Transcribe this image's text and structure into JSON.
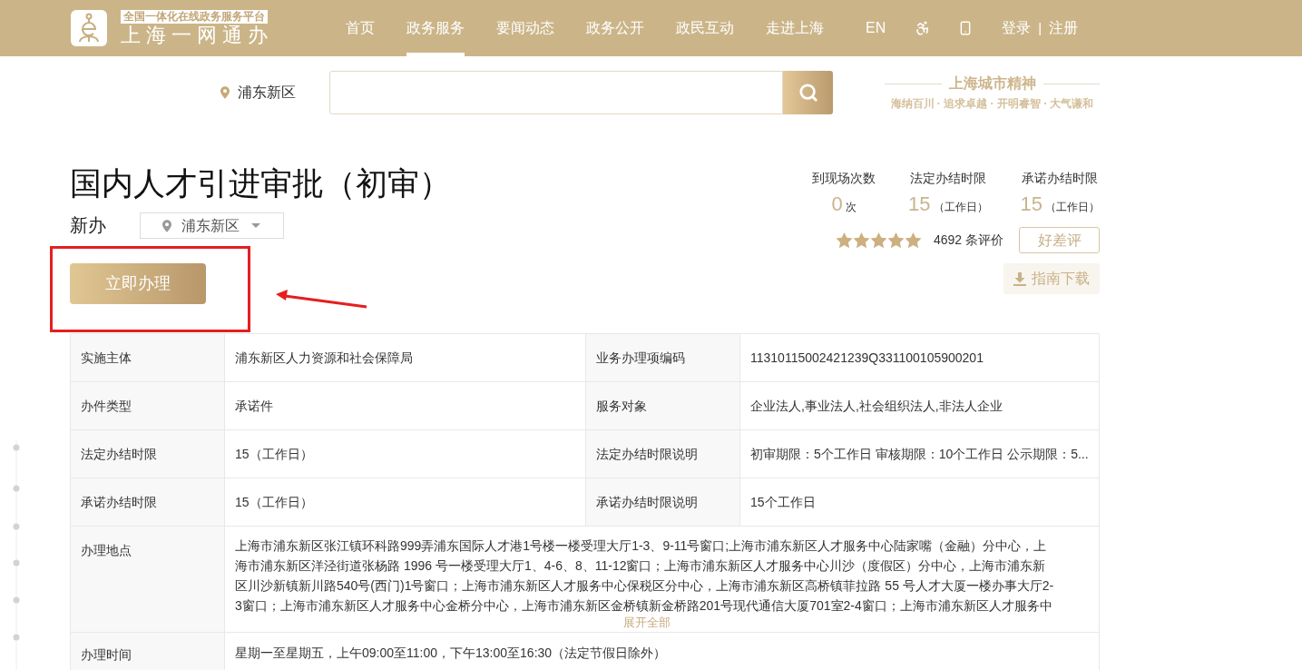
{
  "header": {
    "tagline": "全国一体化在线政务服务平台",
    "site_name": "上海一网通办",
    "nav": [
      {
        "label": "首页",
        "selected": false
      },
      {
        "label": "政务服务",
        "selected": true
      },
      {
        "label": "要闻动态",
        "selected": false
      },
      {
        "label": "政务公开",
        "selected": false
      },
      {
        "label": "政民互动",
        "selected": false
      },
      {
        "label": "走进上海",
        "selected": false
      }
    ],
    "language": "EN",
    "login": "登录",
    "separator": "|",
    "register": "注册"
  },
  "search": {
    "region": "浦东新区"
  },
  "slogan": {
    "title": "上海城市精神",
    "motto": "海纳百川 · 追求卓越 · 开明睿智 · 大气谦和"
  },
  "service": {
    "title": "国内人才引进审批（初审）",
    "type": "新办",
    "region": "浦东新区",
    "action": "立即办理"
  },
  "stats": [
    {
      "label": "到现场次数",
      "value": "0",
      "unit": "次"
    },
    {
      "label": "法定办结时限",
      "value": "15",
      "unit": "（工作日）"
    },
    {
      "label": "承诺办结时限",
      "value": "15",
      "unit": "（工作日）"
    }
  ],
  "rating": {
    "stars": 5,
    "count": "4692 条评价",
    "review_button": "好差评"
  },
  "download_button": "指南下载",
  "table": {
    "rows": [
      {
        "kind": "pair",
        "cells": [
          {
            "label": "实施主体",
            "value": "浦东新区人力资源和社会保障局"
          },
          {
            "label": "业务办理项编码",
            "value": "11310115002421239Q331100105900201"
          }
        ]
      },
      {
        "kind": "pair",
        "cells": [
          {
            "label": "办件类型",
            "value": "承诺件"
          },
          {
            "label": "服务对象",
            "value": "企业法人,事业法人,社会组织法人,非法人企业"
          }
        ]
      },
      {
        "kind": "pair",
        "cells": [
          {
            "label": "法定办结时限",
            "value": "15（工作日）"
          },
          {
            "label": "法定办结时限说明",
            "value": "初审期限：5个工作日 审核期限：10个工作日 公示期限：5..."
          }
        ]
      },
      {
        "kind": "pair",
        "cells": [
          {
            "label": "承诺办结时限",
            "value": "15（工作日）"
          },
          {
            "label": "承诺办结时限说明",
            "value": "15个工作日"
          }
        ]
      },
      {
        "kind": "expandable",
        "label": "办理地点",
        "value": "上海市浦东新区张江镇环科路999弄浦东国际人才港1号楼一楼受理大厅1-3、9-11号窗口;上海市浦东新区人才服务中心陆家嘴（金融）分中心，上海市浦东新区洋泾街道张杨路 1996 号一楼受理大厅1、4-6、8、11-12窗口；上海市浦东新区人才服务中心川沙（度假区）分中心，上海市浦东新区川沙新镇新川路540号(西门)1号窗口；上海市浦东新区人才服务中心保税区分中心，上海市浦东新区高桥镇菲拉路 55 号人才大厦一楼办事大厅2-3窗口；上海市浦东新区人才服务中心金桥分中心，上海市浦东新区金桥镇新金桥路201号现代通信大厦701室2-4窗口；上海市浦东新区人才服务中",
        "expand": "展开全部"
      },
      {
        "kind": "wide",
        "label": "办理时间",
        "value": "星期一至星期五，上午09:00至11:00，下午13:00至16:30（法定节假日除外）"
      }
    ]
  }
}
